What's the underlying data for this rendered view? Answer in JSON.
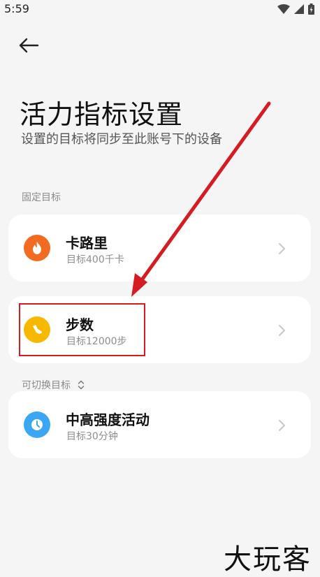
{
  "status_bar": {
    "time": "5:59"
  },
  "header": {
    "title": "活力指标设置",
    "subtitle": "设置的目标将同步至此账号下的设备"
  },
  "sections": {
    "fixed_label": "固定目标",
    "switchable_label": "可切换目标"
  },
  "cards": {
    "calories": {
      "title": "卡路里",
      "subtitle": "目标400千卡",
      "icon": "flame-icon",
      "color": "#f26b21"
    },
    "steps": {
      "title": "步数",
      "subtitle": "目标12000步",
      "icon": "shoe-icon",
      "color": "#f6b900"
    },
    "intense": {
      "title": "中高强度活动",
      "subtitle": "目标30分钟",
      "icon": "clock-icon",
      "color": "#3aa6f4"
    }
  },
  "annotation": {
    "highlight_color": "#d61c22"
  },
  "watermark": "大玩客"
}
